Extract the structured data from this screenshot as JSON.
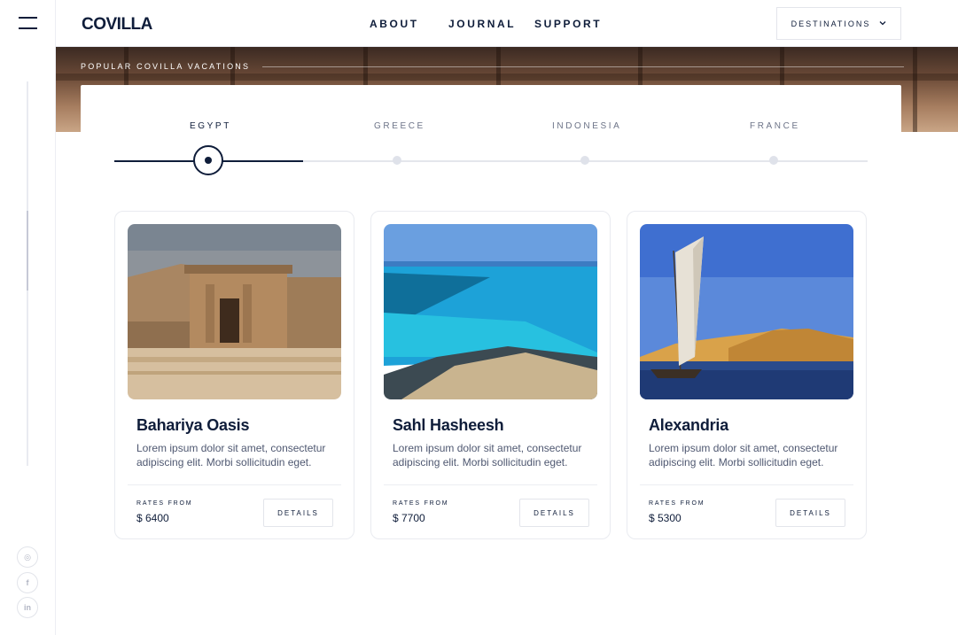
{
  "brand": {
    "logo_text": "COVILLA"
  },
  "nav": {
    "about": "ABOUT",
    "journal": "JOURNAL",
    "support": "SUPPORT"
  },
  "destinations_button": {
    "label": "DESTINATIONS",
    "icon": "chevron-down-icon"
  },
  "hero": {
    "label": "POPULAR COVILLA VACATIONS"
  },
  "tabs": [
    {
      "label": "EGYPT",
      "active": true
    },
    {
      "label": "GREECE",
      "active": false
    },
    {
      "label": "INDONESIA",
      "active": false
    },
    {
      "label": "FRANCE",
      "active": false
    }
  ],
  "cards": [
    {
      "title": "Bahariya Oasis",
      "description": "Lorem ipsum dolor sit amet, consectetur adipiscing elit. Morbi sollicitudin eget.",
      "rates_label": "RATES FROM",
      "price": "$ 6400",
      "button": "DETAILS"
    },
    {
      "title": "Sahl Hasheesh",
      "description": "Lorem ipsum dolor sit amet, consectetur adipiscing elit. Morbi sollicitudin eget.",
      "rates_label": "RATES FROM",
      "price": "$ 7700",
      "button": "DETAILS"
    },
    {
      "title": "Alexandria",
      "description": "Lorem ipsum dolor sit amet, consectetur adipiscing elit. Morbi sollicitudin eget.",
      "rates_label": "RATES FROM",
      "price": "$ 5300",
      "button": "DETAILS"
    }
  ],
  "social": [
    {
      "icon": "instagram-icon",
      "glyph": "◎"
    },
    {
      "icon": "facebook-icon",
      "glyph": "f"
    },
    {
      "icon": "linkedin-icon",
      "glyph": "in"
    }
  ],
  "colors": {
    "primary": "#0f1d3a",
    "muted": "#6d7488",
    "border": "#e9ebf0"
  }
}
